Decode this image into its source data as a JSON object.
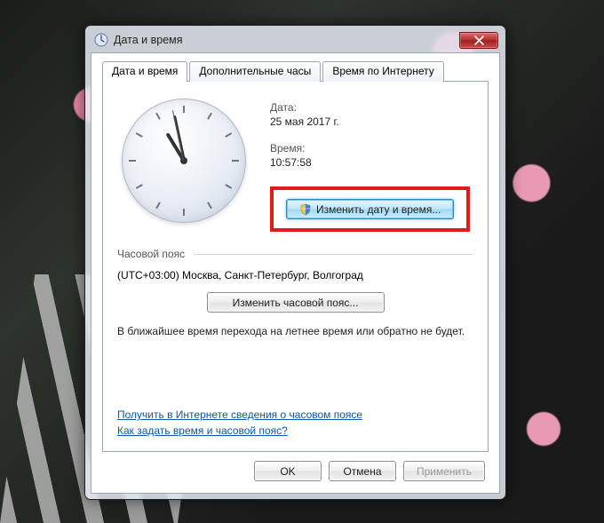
{
  "window": {
    "title": "Дата и время"
  },
  "tabs": [
    {
      "label": "Дата и время"
    },
    {
      "label": "Дополнительные часы"
    },
    {
      "label": "Время по Интернету"
    }
  ],
  "date": {
    "label": "Дата:",
    "value": "25 мая 2017 г."
  },
  "time": {
    "label": "Время:",
    "value": "10:57:58",
    "hours": 10,
    "minutes": 57,
    "seconds": 58
  },
  "buttons": {
    "change_datetime": "Изменить дату и время...",
    "change_timezone": "Изменить часовой пояс...",
    "ok": "OK",
    "cancel": "Отмена",
    "apply": "Применить"
  },
  "timezone": {
    "section_label": "Часовой пояс",
    "value": "(UTC+03:00) Москва, Санкт-Петербург, Волгоград"
  },
  "dst_note": "В ближайшее время перехода на летнее время или обратно не будет.",
  "links": {
    "tz_info": "Получить в Интернете сведения о часовом поясе",
    "howto": "Как задать время и часовой пояс?"
  }
}
